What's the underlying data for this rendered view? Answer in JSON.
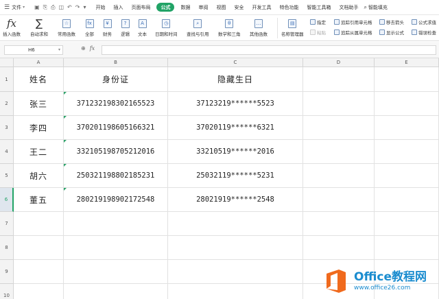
{
  "menu": {
    "file": "文件",
    "tabs": [
      "开始",
      "插入",
      "页面布局",
      "公式",
      "数据",
      "审阅",
      "视图",
      "安全",
      "开发工具",
      "特色功能",
      "智能工具箱",
      "文档助手"
    ],
    "active_tab": "公式",
    "search": "智能填充"
  },
  "ribbon": {
    "insert_function": "插入函数",
    "autosum": "自动求和",
    "common_functions": "常用函数",
    "all": "全部",
    "financial": "财务",
    "logical": "逻辑",
    "text": "文本",
    "date_time": "日期和时间",
    "lookup": "查找与引用",
    "math_trig": "数学和三角",
    "other_functions": "其他函数",
    "name_manager": "名称管理器",
    "specify": "指定",
    "paste": "粘贴",
    "trace_precedents": "追踪引用单元格",
    "trace_dependents": "追踪从属单元格",
    "remove_arrows": "移去箭头",
    "show_formulas": "显示公式",
    "formula_eval": "公式求值",
    "error_check": "错误检查"
  },
  "formula_bar": {
    "name_box": "H6",
    "fx_label": "fx",
    "value": ""
  },
  "grid": {
    "columns": [
      "A",
      "B",
      "C",
      "D",
      "E"
    ],
    "rows": [
      "1",
      "2",
      "3",
      "4",
      "5",
      "6",
      "7",
      "8",
      "9",
      "10"
    ],
    "selected_row": "6",
    "headers": [
      "姓名",
      "身份证",
      "隐藏生日"
    ],
    "data": [
      [
        "张三",
        "371232198302165523",
        "37123219******5523"
      ],
      [
        "李四",
        "370201198605166321",
        "37020119******6321"
      ],
      [
        "王二",
        "332105198705212016",
        "33210519******2016"
      ],
      [
        "胡六",
        "250321198802185231",
        "25032119******5231"
      ],
      [
        "董五",
        "280219198902172548",
        "28021919******2548"
      ]
    ]
  },
  "watermark": {
    "brand": "Office教程网",
    "url": "www.office26.com",
    "color": "#1a8ccf",
    "accent": "#f06a1d"
  },
  "colors": {
    "accent_green": "#21a366"
  }
}
